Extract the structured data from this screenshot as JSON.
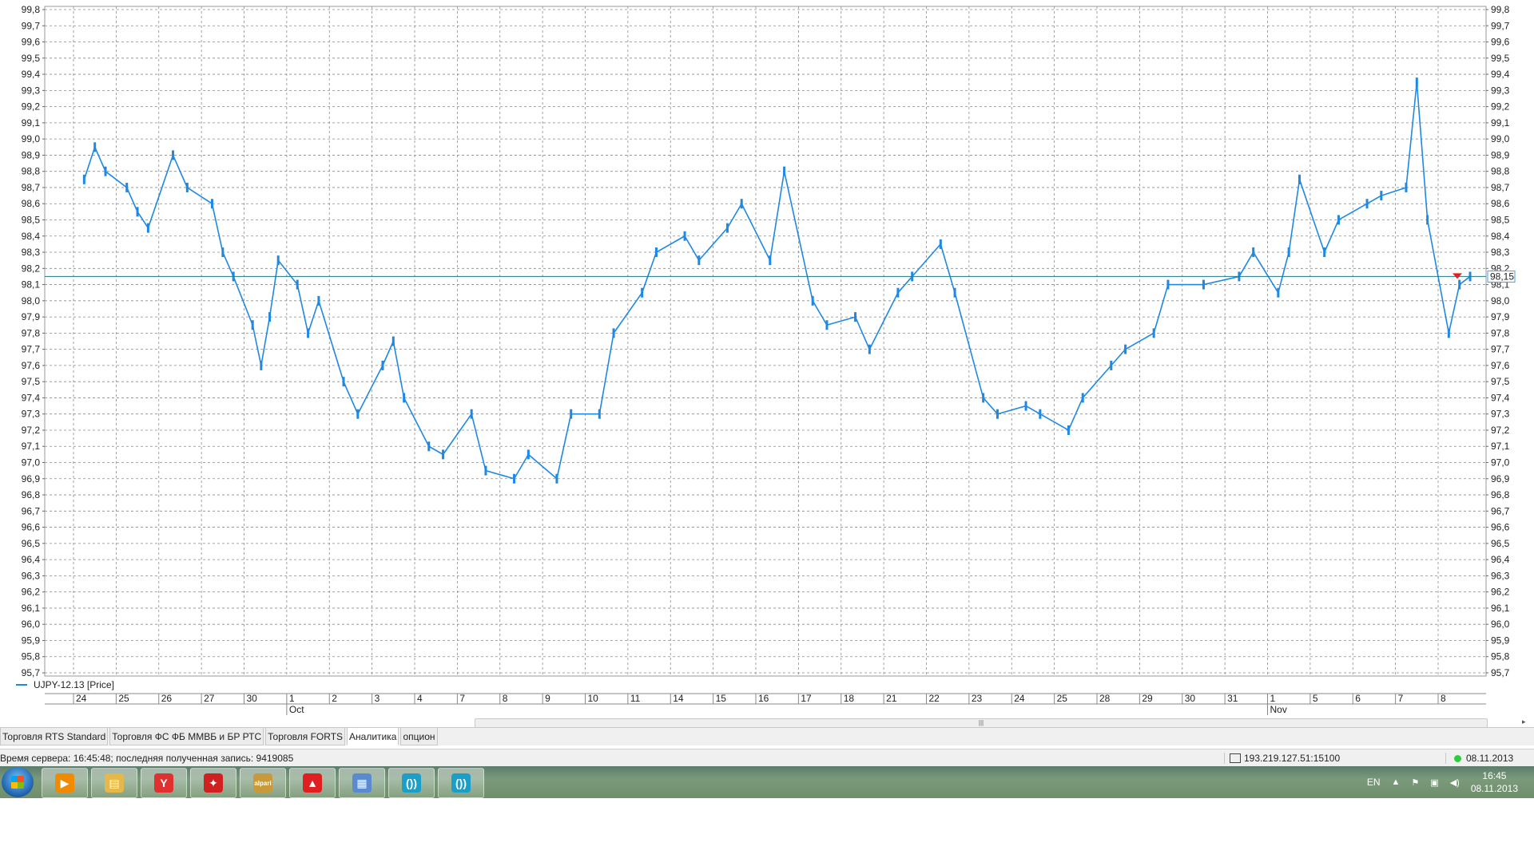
{
  "chart_data": {
    "type": "line",
    "series": [
      {
        "name": "UJPY-12.13 [Price]",
        "color": "#1e88e5",
        "points": [
          [
            "24",
            98.75
          ],
          [
            "24",
            98.95
          ],
          [
            "24",
            98.8
          ],
          [
            "25",
            98.7
          ],
          [
            "25",
            98.55
          ],
          [
            "25",
            98.45
          ],
          [
            "26",
            98.9
          ],
          [
            "26",
            98.7
          ],
          [
            "27",
            98.6
          ],
          [
            "27",
            98.3
          ],
          [
            "27",
            98.15
          ],
          [
            "30",
            97.85
          ],
          [
            "30",
            97.6
          ],
          [
            "30",
            97.9
          ],
          [
            "30",
            98.25
          ],
          [
            "1",
            98.1
          ],
          [
            "1",
            97.8
          ],
          [
            "1",
            98.0
          ],
          [
            "2",
            97.5
          ],
          [
            "2",
            97.3
          ],
          [
            "3",
            97.6
          ],
          [
            "3",
            97.75
          ],
          [
            "3",
            97.4
          ],
          [
            "4",
            97.1
          ],
          [
            "4",
            97.05
          ],
          [
            "7",
            97.3
          ],
          [
            "7",
            96.95
          ],
          [
            "8",
            96.9
          ],
          [
            "8",
            97.05
          ],
          [
            "9",
            96.9
          ],
          [
            "9",
            97.3
          ],
          [
            "10",
            97.3
          ],
          [
            "10",
            97.8
          ],
          [
            "11",
            98.05
          ],
          [
            "11",
            98.3
          ],
          [
            "14",
            98.4
          ],
          [
            "14",
            98.25
          ],
          [
            "15",
            98.45
          ],
          [
            "15",
            98.6
          ],
          [
            "16",
            98.25
          ],
          [
            "16",
            98.8
          ],
          [
            "17",
            98.0
          ],
          [
            "17",
            97.85
          ],
          [
            "18",
            97.9
          ],
          [
            "18",
            97.7
          ],
          [
            "21",
            98.05
          ],
          [
            "21",
            98.15
          ],
          [
            "22",
            98.35
          ],
          [
            "22",
            98.05
          ],
          [
            "23",
            97.4
          ],
          [
            "23",
            97.3
          ],
          [
            "24",
            97.35
          ],
          [
            "24",
            97.3
          ],
          [
            "25",
            97.2
          ],
          [
            "25",
            97.4
          ],
          [
            "28",
            97.6
          ],
          [
            "28",
            97.7
          ],
          [
            "29",
            97.8
          ],
          [
            "29",
            98.1
          ],
          [
            "30",
            98.1
          ],
          [
            "31",
            98.15
          ],
          [
            "31",
            98.3
          ],
          [
            "1",
            98.05
          ],
          [
            "1",
            98.3
          ],
          [
            "1",
            98.75
          ],
          [
            "5",
            98.3
          ],
          [
            "5",
            98.5
          ],
          [
            "6",
            98.6
          ],
          [
            "6",
            98.65
          ],
          [
            "7",
            98.7
          ],
          [
            "7",
            99.35
          ],
          [
            "7",
            98.5
          ],
          [
            "8",
            97.8
          ],
          [
            "8",
            98.1
          ],
          [
            "8",
            98.15
          ]
        ]
      }
    ],
    "ylim": [
      95.7,
      99.8
    ],
    "y_ticks": [
      "99,8",
      "99,7",
      "99,6",
      "99,5",
      "99,4",
      "99,3",
      "99,2",
      "99,1",
      "99,0",
      "98,9",
      "98,8",
      "98,7",
      "98,6",
      "98,5",
      "98,4",
      "98,3",
      "98,2",
      "98,1",
      "98,0",
      "97,9",
      "97,8",
      "97,7",
      "97,6",
      "97,5",
      "97,4",
      "97,3",
      "97,2",
      "97,1",
      "97,0",
      "96,9",
      "96,8",
      "96,7",
      "96,6",
      "96,5",
      "96,4",
      "96,3",
      "96,2",
      "96,1",
      "96,0",
      "95,9",
      "95,8",
      "95,7"
    ],
    "x_day_labels": [
      "24",
      "25",
      "26",
      "27",
      "30",
      "1",
      "2",
      "3",
      "4",
      "7",
      "8",
      "9",
      "10",
      "11",
      "14",
      "15",
      "16",
      "17",
      "18",
      "21",
      "22",
      "23",
      "24",
      "25",
      "28",
      "29",
      "30",
      "31",
      "1",
      "5",
      "6",
      "7",
      "8"
    ],
    "x_month_labels": [
      {
        "label": "Oct",
        "after_day_index": 5
      },
      {
        "label": "Nov",
        "after_day_index": 28
      }
    ],
    "current_price_label": "98,15",
    "current_price_value": 98.15,
    "grid": true,
    "legend_placement": "bottom-left"
  },
  "legend": {
    "label": "UJPY-12.13 [Price]",
    "color": "#1e88e5"
  },
  "tabs": [
    {
      "label": "Торговля RTS Standard",
      "active": false
    },
    {
      "label": "Торговля ФС ФБ ММВБ и БР РТС",
      "active": false
    },
    {
      "label": "Торговля FORTS",
      "active": false
    },
    {
      "label": "Аналитика",
      "active": true
    },
    {
      "label": "опцион",
      "active": false
    }
  ],
  "status": {
    "server_text": "Время сервера: 16:45:48; последняя полученная запись: 9419085",
    "connection": "193.219.127.51:15100",
    "date": "08.11.2013"
  },
  "taskbar": {
    "items": [
      {
        "name": "media-player-icon",
        "glyph": "▶",
        "color": "#f08a00"
      },
      {
        "name": "explorer-folder-icon",
        "glyph": "▤",
        "color": "#e6b84a"
      },
      {
        "name": "yandex-browser-icon",
        "glyph": "Y",
        "color": "#e03030"
      },
      {
        "name": "trading-app-icon",
        "glyph": "✦",
        "color": "#d02020"
      },
      {
        "name": "alpari-icon",
        "glyph": "alpari",
        "color": "#c89a3a"
      },
      {
        "name": "alfa-app-icon",
        "glyph": "▲",
        "color": "#e02020"
      },
      {
        "name": "calculator-icon",
        "glyph": "▦",
        "color": "#5a8ad0"
      },
      {
        "name": "quik-icon-1",
        "glyph": "())",
        "color": "#1aa0c8"
      },
      {
        "name": "quik-icon-2",
        "glyph": "())",
        "color": "#1aa0c8"
      }
    ],
    "tray": {
      "lang": "EN",
      "time": "16:45",
      "date": "08.11.2013"
    }
  }
}
